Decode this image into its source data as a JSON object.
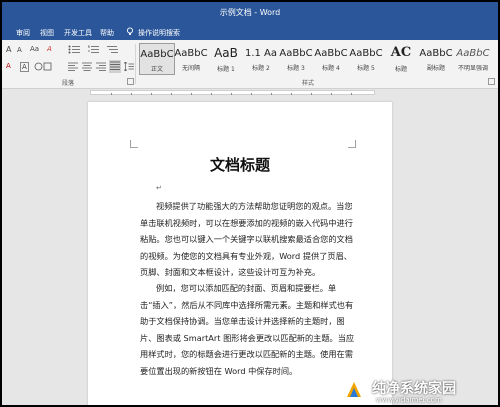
{
  "window": {
    "title": "示例文档 - Word"
  },
  "menu": {
    "items": [
      "审阅",
      "视图",
      "开发工具",
      "帮助"
    ],
    "tell_me": "操作说明搜索"
  },
  "ribbon": {
    "format_row1": [
      "A",
      "A",
      "Aa",
      "A"
    ],
    "format_row2": [
      "A",
      "A"
    ],
    "paragraph_label": "段落",
    "styles_label": "样式",
    "styles": [
      {
        "sample": "AaBbC",
        "name": "正文",
        "selected": true
      },
      {
        "sample": "AaBbC",
        "name": "无间隔"
      },
      {
        "sample": "AaB",
        "name": "标题 1"
      },
      {
        "sample": "1.1 Aa",
        "name": "标题 2"
      },
      {
        "sample": "AaBbC",
        "name": "标题 3"
      },
      {
        "sample": "AaBbC",
        "name": "标题 4"
      },
      {
        "sample": "AaBbC",
        "name": "标题 5"
      },
      {
        "sample": "AC",
        "name": "标题"
      },
      {
        "sample": "AaBbC",
        "name": "副标题"
      },
      {
        "sample": "AaBbC",
        "name": "不明显强调"
      }
    ]
  },
  "document": {
    "title": "文档标题",
    "paragraphs": [
      "视频提供了功能强大的方法帮助您证明您的观点。当您单击联机视频时，可以在想要添加的视频的嵌入代码中进行粘贴。您也可以键入一个关键字以联机搜索最适合您的文档的视频。为使您的文档具有专业外观，Word 提供了页眉、页脚、封面和文本框设计，这些设计可互为补充。",
      "例如，您可以添加匹配的封面、页眉和提要栏。单击“插入”，然后从不同库中选择所需元素。主题和样式也有助于文档保持协调。当您单击设计并选择新的主题时，图片、图表或 SmartArt 图形将会更改以匹配新的主题。当应用样式时，您的标题会进行更改以匹配新的主题。使用在需要位置出现的新按钮在 Word 中保存时间。"
    ]
  },
  "watermark": {
    "text": "纯净系统家园",
    "url": "www.yidaimei.com"
  },
  "colors": {
    "title_bar": "#2b579a",
    "ribbon": "#f3f3f3",
    "canvas": "#e6e6e6"
  }
}
